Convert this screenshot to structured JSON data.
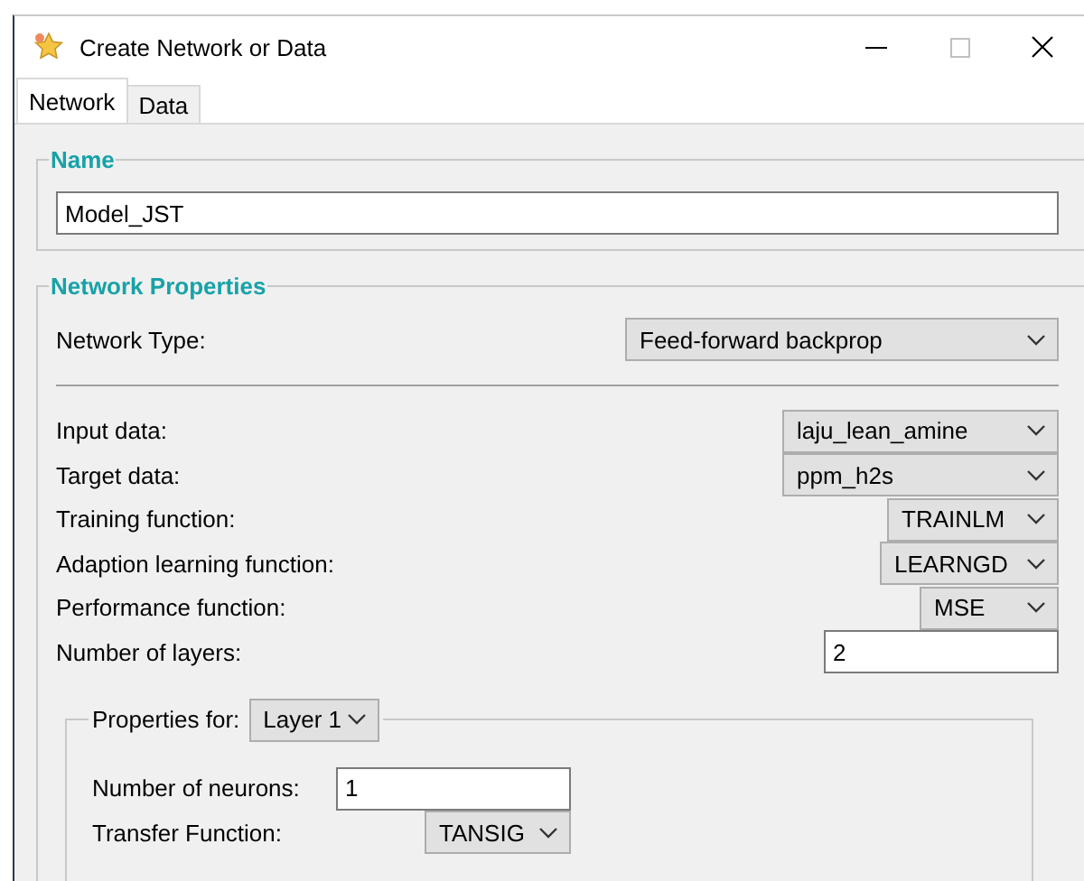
{
  "window": {
    "title": "Create Network or Data"
  },
  "tabs": [
    {
      "label": "Network",
      "selected": true
    },
    {
      "label": "Data",
      "selected": false
    }
  ],
  "name_section": {
    "legend": "Name",
    "value": "Model_JST"
  },
  "network_properties": {
    "legend": "Network Properties",
    "network_type": {
      "label": "Network Type:",
      "value": "Feed-forward backprop"
    },
    "fields": [
      {
        "kind": "dropdown",
        "label": "Input data:",
        "value": "laju_lean_amine"
      },
      {
        "kind": "dropdown",
        "label": "Target data:",
        "value": "ppm_h2s"
      },
      {
        "kind": "dropdown",
        "label": "Training function:",
        "value": "TRAINLM"
      },
      {
        "kind": "dropdown",
        "label": "Adaption learning function:",
        "value": "LEARNGD"
      },
      {
        "kind": "dropdown",
        "label": "Performance function:",
        "value": "MSE"
      },
      {
        "kind": "input",
        "label": "Number of layers:",
        "value": "2"
      }
    ],
    "layer_properties": {
      "label": "Properties for:",
      "layer": "Layer 1",
      "fields": [
        {
          "kind": "input",
          "label": "Number of neurons:",
          "value": "1"
        },
        {
          "kind": "dropdown",
          "label": "Transfer Function:",
          "value": "TANSIG"
        }
      ]
    }
  }
}
